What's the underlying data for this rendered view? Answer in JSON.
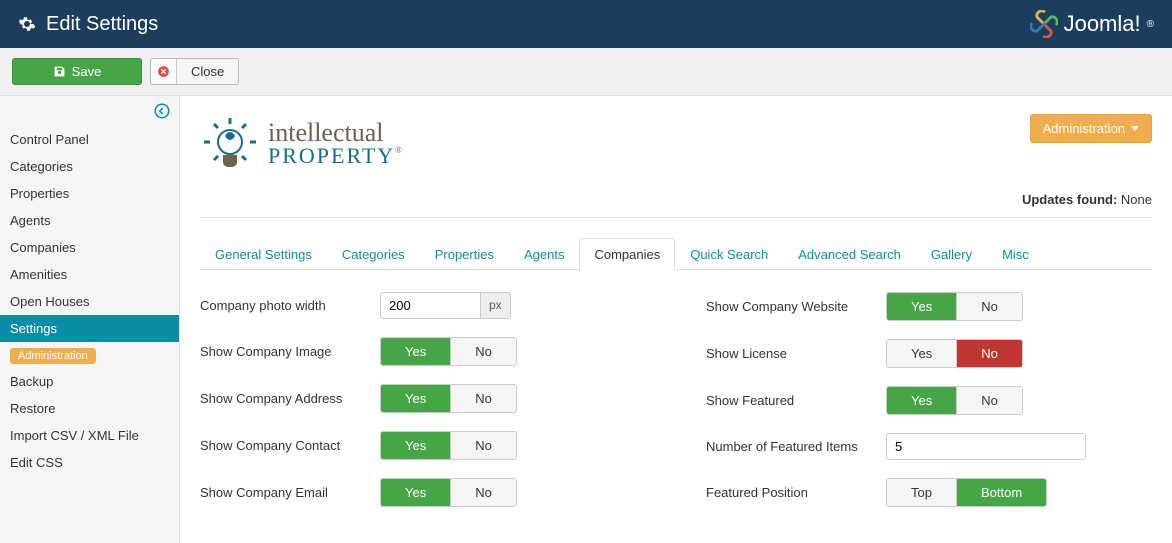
{
  "topbar": {
    "title": "Edit Settings",
    "brand": "Joomla!"
  },
  "toolbar": {
    "save": "Save",
    "close": "Close"
  },
  "sidebar": {
    "items": [
      {
        "label": "Control Panel",
        "active": false
      },
      {
        "label": "Categories",
        "active": false
      },
      {
        "label": "Properties",
        "active": false
      },
      {
        "label": "Agents",
        "active": false
      },
      {
        "label": "Companies",
        "active": false
      },
      {
        "label": "Amenities",
        "active": false
      },
      {
        "label": "Open Houses",
        "active": false
      },
      {
        "label": "Settings",
        "active": true
      }
    ],
    "badge": "Administration",
    "admin_items": [
      {
        "label": "Backup"
      },
      {
        "label": "Restore"
      },
      {
        "label": "Import CSV / XML File"
      },
      {
        "label": "Edit CSS"
      }
    ]
  },
  "main": {
    "logo": {
      "line1": "intellectual",
      "line2": "PROPERTY"
    },
    "admin_button": "Administration",
    "updates_label": "Updates found:",
    "updates_value": "None"
  },
  "tabs": [
    {
      "label": "General Settings",
      "active": false
    },
    {
      "label": "Categories",
      "active": false
    },
    {
      "label": "Properties",
      "active": false
    },
    {
      "label": "Agents",
      "active": false
    },
    {
      "label": "Companies",
      "active": true
    },
    {
      "label": "Quick Search",
      "active": false
    },
    {
      "label": "Advanced Search",
      "active": false
    },
    {
      "label": "Gallery",
      "active": false
    },
    {
      "label": "Misc",
      "active": false
    }
  ],
  "form": {
    "left": [
      {
        "label": "Company photo width",
        "type": "input-addon",
        "value": "200",
        "addon": "px"
      },
      {
        "label": "Show Company Image",
        "type": "yesno",
        "value": "Yes"
      },
      {
        "label": "Show Company Address",
        "type": "yesno",
        "value": "Yes"
      },
      {
        "label": "Show Company Contact",
        "type": "yesno",
        "value": "Yes"
      },
      {
        "label": "Show Company Email",
        "type": "yesno",
        "value": "Yes"
      }
    ],
    "right": [
      {
        "label": "Show Company Website",
        "type": "yesno",
        "value": "Yes"
      },
      {
        "label": "Show License",
        "type": "yesno",
        "value": "No"
      },
      {
        "label": "Show Featured",
        "type": "yesno",
        "value": "Yes"
      },
      {
        "label": "Number of Featured Items",
        "type": "input",
        "value": "5"
      },
      {
        "label": "Featured Position",
        "type": "topbottom",
        "value": "Bottom"
      }
    ],
    "labels": {
      "yes": "Yes",
      "no": "No",
      "top": "Top",
      "bottom": "Bottom"
    }
  }
}
